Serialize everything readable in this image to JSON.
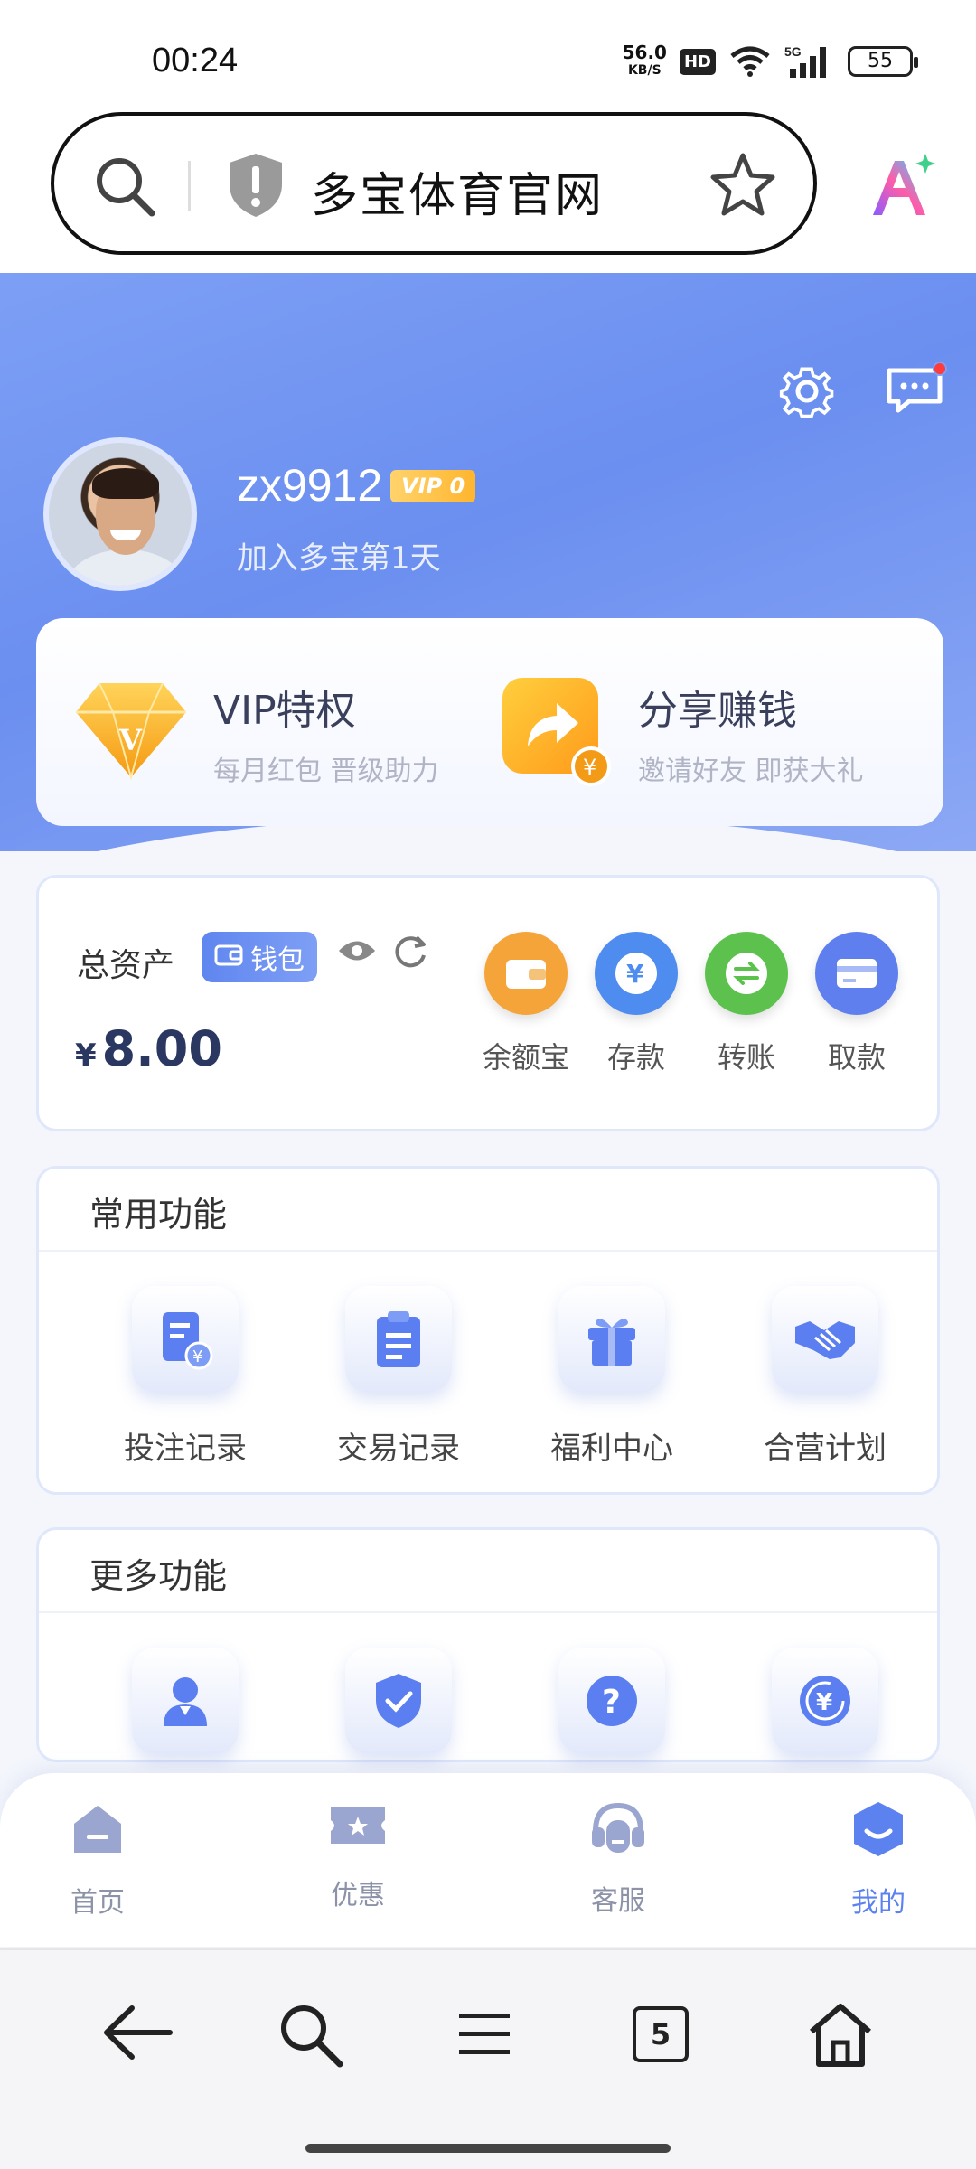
{
  "status_bar": {
    "time": "00:24",
    "net_speed": "56.0",
    "net_unit": "KB/S",
    "hd": "HD",
    "signal": "5G",
    "battery": "55"
  },
  "browser": {
    "url_text": "多宝体育官网",
    "tab_count": "5"
  },
  "profile": {
    "username": "zx9912",
    "vip_level": "VIP 0",
    "join_text": "加入多宝第1天"
  },
  "promo": {
    "vip_title": "VIP特权",
    "vip_sub": "每月红包 晋级助力",
    "share_title": "分享赚钱",
    "share_sub": "邀请好友 即获大礼"
  },
  "assets": {
    "label": "总资产",
    "wallet_label": "钱包",
    "currency": "¥",
    "amount": "8.00",
    "actions": [
      {
        "label": "余额宝",
        "color": "#f5a43a"
      },
      {
        "label": "存款",
        "color": "#4f8cf0"
      },
      {
        "label": "转账",
        "color": "#5cc24d"
      },
      {
        "label": "取款",
        "color": "#5f7fee"
      }
    ]
  },
  "common_functions": {
    "title": "常用功能",
    "items": [
      {
        "label": "投注记录",
        "icon": "bet-record-icon"
      },
      {
        "label": "交易记录",
        "icon": "transaction-record-icon"
      },
      {
        "label": "福利中心",
        "icon": "gift-icon"
      },
      {
        "label": "合营计划",
        "icon": "handshake-icon"
      }
    ]
  },
  "more_functions": {
    "title": "更多功能",
    "items": [
      {
        "icon": "user-profile-icon"
      },
      {
        "icon": "security-shield-icon"
      },
      {
        "icon": "help-question-icon"
      },
      {
        "icon": "rebate-yen-icon"
      }
    ]
  },
  "tabbar": {
    "items": [
      {
        "label": "首页"
      },
      {
        "label": "优惠"
      },
      {
        "label": "客服"
      },
      {
        "label": "我的"
      }
    ],
    "active_color": "#5b82ef"
  }
}
